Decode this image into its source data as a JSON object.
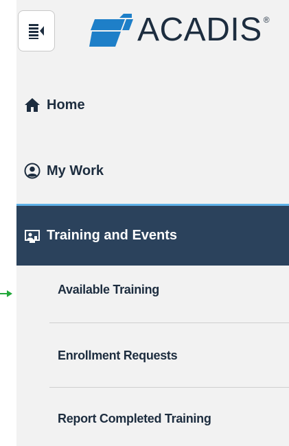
{
  "logo": {
    "text": "ACADIS",
    "registered": "®"
  },
  "nav": {
    "home": "Home",
    "my_work": "My Work",
    "training": "Training and Events"
  },
  "subnav": [
    "Available Training",
    "Enrollment Requests",
    "Report Completed Training"
  ],
  "colors": {
    "active_bg": "#2b425c",
    "active_border": "#5fb2e8",
    "sidebar_bg": "#f2f2f2",
    "text_dark": "#1d2d3f",
    "logo_blue": "#1e7fc8",
    "pointer_green": "#22a83a"
  },
  "icons": {
    "toggle": "sidebar-collapse-icon",
    "logo": "acadis-logo-icon",
    "home": "home-icon",
    "my_work": "user-circle-icon",
    "training": "training-icon",
    "pointer": "arrow-pointer-icon"
  }
}
